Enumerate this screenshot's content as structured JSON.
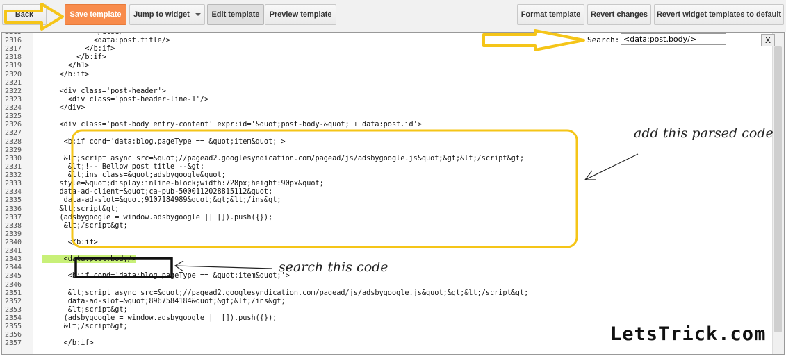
{
  "toolbar": {
    "back_label": "Back",
    "save_label": "Save template",
    "jump_label": "Jump to widget",
    "edit_label": "Edit template",
    "preview_label": "Preview template",
    "format_label": "Format template",
    "revert_label": "Revert changes",
    "revert_widgets_label": "Revert widget templates to default"
  },
  "search": {
    "label": "Search:",
    "value": "<data:post.body/>",
    "close_label": "X"
  },
  "editor": {
    "lines": [
      {
        "n": "2315",
        "text": "            </else/>"
      },
      {
        "n": "2316",
        "text": "            <data:post.title/>"
      },
      {
        "n": "2317",
        "text": "          </b:if>"
      },
      {
        "n": "2318",
        "text": "        </b:if>"
      },
      {
        "n": "2319",
        "text": "      </h1>"
      },
      {
        "n": "2320",
        "text": "    </b:if>"
      },
      {
        "n": "2321",
        "text": ""
      },
      {
        "n": "2322",
        "text": "    <div class='post-header'>"
      },
      {
        "n": "2323",
        "text": "      <div class='post-header-line-1'/>"
      },
      {
        "n": "2324",
        "text": "    </div>"
      },
      {
        "n": "2325",
        "text": ""
      },
      {
        "n": "2326",
        "text": "    <div class='post-body entry-content' expr:id='&quot;post-body-&quot; + data:post.id'>"
      },
      {
        "n": "2327",
        "text": ""
      },
      {
        "n": "2328",
        "text": "     <b:if cond='data:blog.pageType == &quot;item&quot;'>"
      },
      {
        "n": "2329",
        "text": ""
      },
      {
        "n": "2330",
        "text": "     &lt;script async src=&quot;//pagead2.googlesyndication.com/pagead/js/adsbygoogle.js&quot;&gt;&lt;/script&gt;"
      },
      {
        "n": "2331",
        "text": "      &lt;!-- Bellow post title --&gt;"
      },
      {
        "n": "2332",
        "text": "      &lt;ins class=&quot;adsbygoogle&quot;"
      },
      {
        "n": "2333",
        "text": "    style=&quot;display:inline-block;width:728px;height:90px&quot;"
      },
      {
        "n": "2334",
        "text": "    data-ad-client=&quot;ca-pub-5000112028815112&quot;"
      },
      {
        "n": "2335",
        "text": "     data-ad-slot=&quot;9107184989&quot;&gt;&lt;/ins&gt;"
      },
      {
        "n": "2336",
        "text": "    &lt;script&gt;"
      },
      {
        "n": "2337",
        "text": "    (adsbygoogle = window.adsbygoogle || []).push({});"
      },
      {
        "n": "2338",
        "text": "     &lt;/script&gt;"
      },
      {
        "n": "2339",
        "text": ""
      },
      {
        "n": "2340",
        "text": "      </b:if>"
      },
      {
        "n": "2341",
        "text": ""
      },
      {
        "n": "2343",
        "text": "     <data:post.body/>",
        "highlight": true
      },
      {
        "n": "2344",
        "text": ""
      },
      {
        "n": "2345",
        "text": "      <b:if cond='data:blog.pageType == &quot;item&quot;'>"
      },
      {
        "n": "2346",
        "text": ""
      },
      {
        "n": "2351",
        "text": "      &lt;script async src=&quot;//pagead2.googlesyndication.com/pagead/js/adsbygoogle.js&quot;&gt;&lt;/script&gt;"
      },
      {
        "n": "2352",
        "text": "      data-ad-slot=&quot;8967584184&quot;&gt;&lt;/ins&gt;"
      },
      {
        "n": "2353",
        "text": "      &lt;script&gt;"
      },
      {
        "n": "2354",
        "text": "     (adsbygoogle = window.adsbygoogle || []).push({});"
      },
      {
        "n": "2355",
        "text": "     &lt;/script&gt;"
      },
      {
        "n": "2356",
        "text": ""
      },
      {
        "n": "2357",
        "text": "     </b:if>"
      }
    ]
  },
  "annotations": {
    "add_code": "add this parsed code",
    "search_code": "search this code",
    "brand": "LetsTrick.com"
  },
  "colors": {
    "save_button": "#f88b4b",
    "annotation_yellow": "#f5c518",
    "highlight_green": "#c8f078"
  }
}
